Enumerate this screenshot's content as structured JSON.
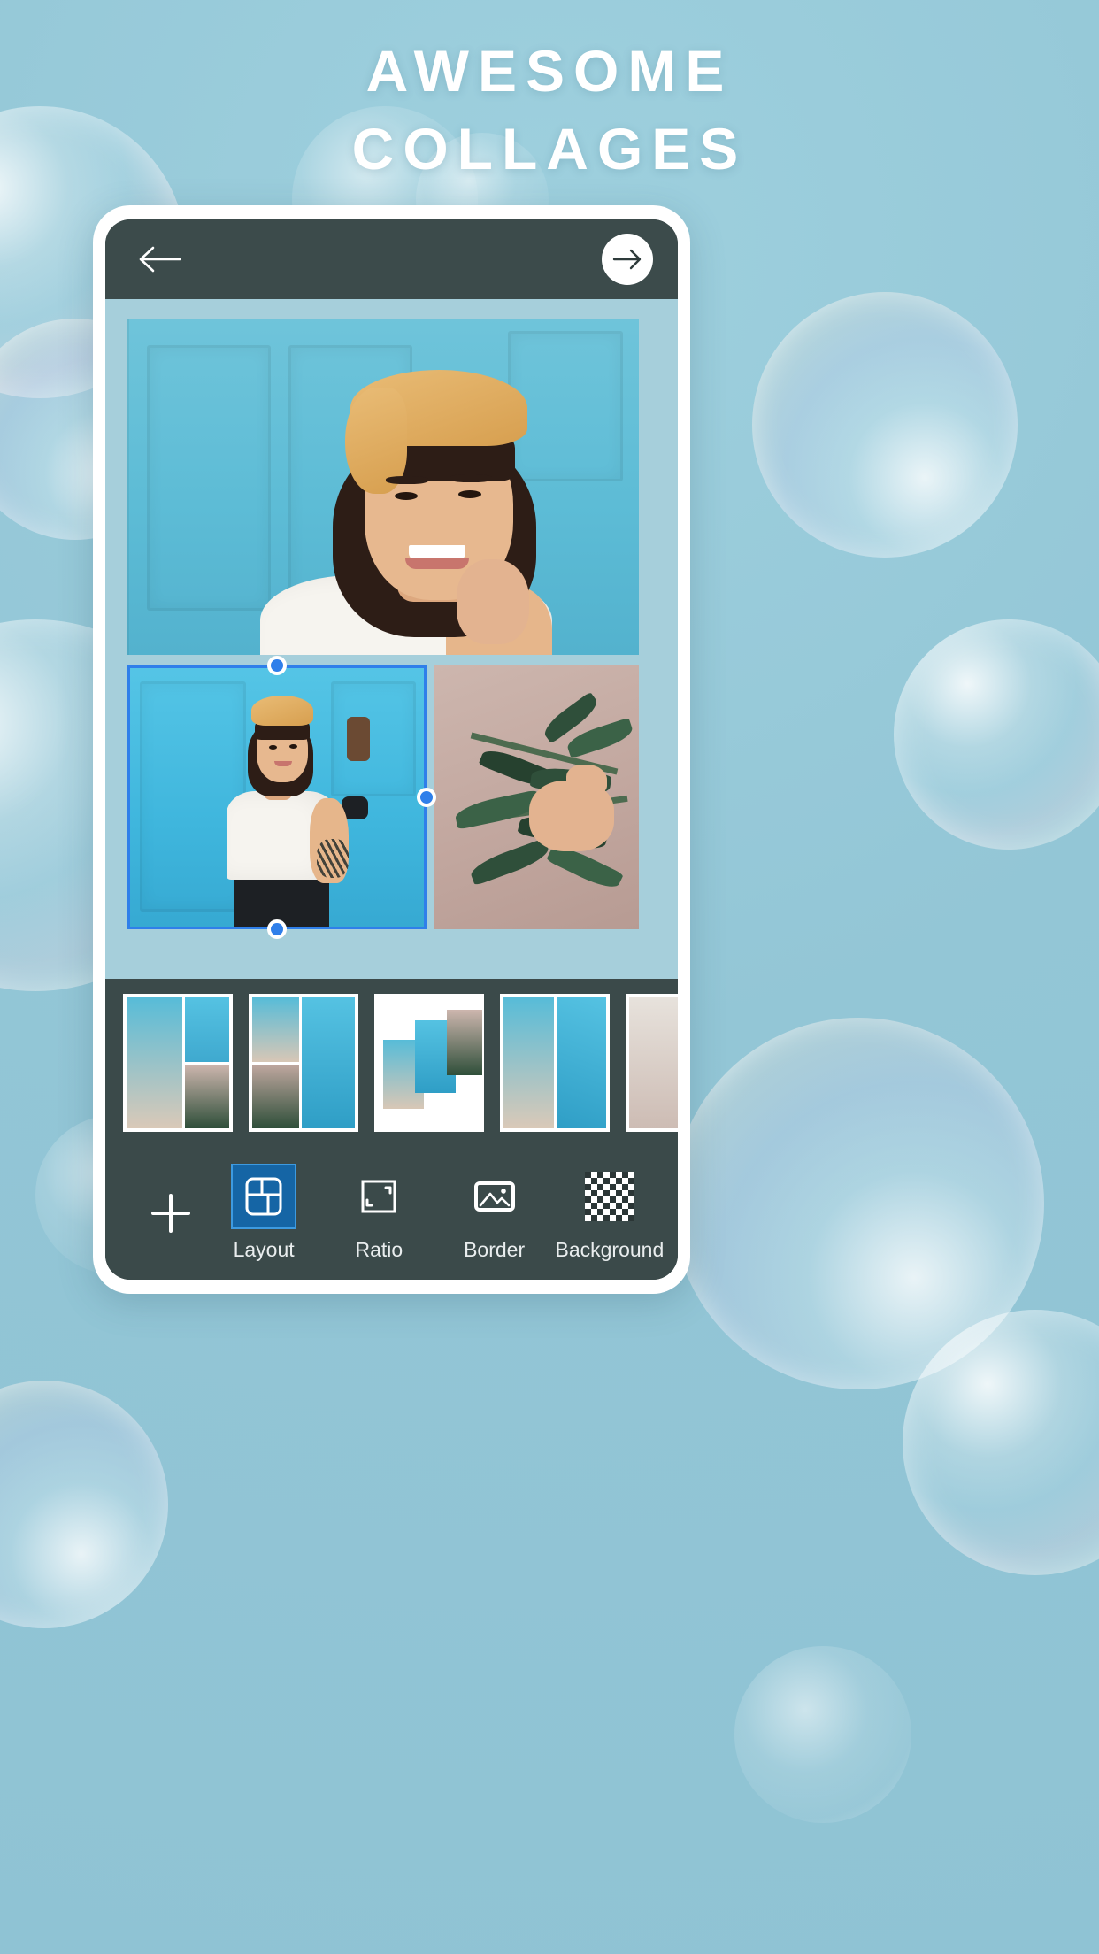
{
  "headline": {
    "line1": "AWESOME",
    "line2": "COLLAGES"
  },
  "colors": {
    "page_background": "#93c6d6",
    "phone_frame": "#ffffff",
    "app_bar": "#3c4b4b",
    "canvas_background": "#a6cfdb",
    "accent_blue": "#2f7fea",
    "active_tool_fill": "#1565a5",
    "toolbar_background": "#3b4a4a",
    "toolbar_label": "#e9edee"
  },
  "app": {
    "topbar": {
      "back_button": {
        "icon": "arrow-left-icon",
        "label": "Back"
      },
      "next_button": {
        "icon": "arrow-right-icon",
        "label": "Next"
      }
    },
    "canvas": {
      "selected_cell": "bottom-left",
      "cells": [
        {
          "id": "top",
          "content": "portrait-woman-yellow-turban-smiling",
          "selected": false
        },
        {
          "id": "bottom-left",
          "content": "woman-yellow-turban-hand-on-hip-blue-door",
          "selected": true
        },
        {
          "id": "bottom-right",
          "content": "hand-holding-olive-branch",
          "selected": false
        }
      ],
      "handles": [
        "top-handle",
        "right-handle",
        "bottom-handle"
      ]
    },
    "layout_strip": {
      "items": [
        {
          "id": "layout-1",
          "label": "Layout 1",
          "selected": false
        },
        {
          "id": "layout-2",
          "label": "Layout 2",
          "selected": false
        },
        {
          "id": "layout-3",
          "label": "Layout 3",
          "selected": false
        },
        {
          "id": "layout-4",
          "label": "Layout 4",
          "selected": false
        },
        {
          "id": "layout-5",
          "label": "Layout 5",
          "selected": false
        }
      ]
    },
    "toolbar": {
      "add_button": {
        "icon": "plus-icon",
        "label": "Add"
      },
      "tools": [
        {
          "id": "layout",
          "label": "Layout",
          "icon": "grid-layout-icon",
          "active": true
        },
        {
          "id": "ratio",
          "label": "Ratio",
          "icon": "crop-corners-icon",
          "active": false
        },
        {
          "id": "border",
          "label": "Border",
          "icon": "image-icon",
          "active": false
        },
        {
          "id": "background",
          "label": "Background",
          "icon": "checkerboard-icon",
          "active": false
        }
      ]
    }
  }
}
